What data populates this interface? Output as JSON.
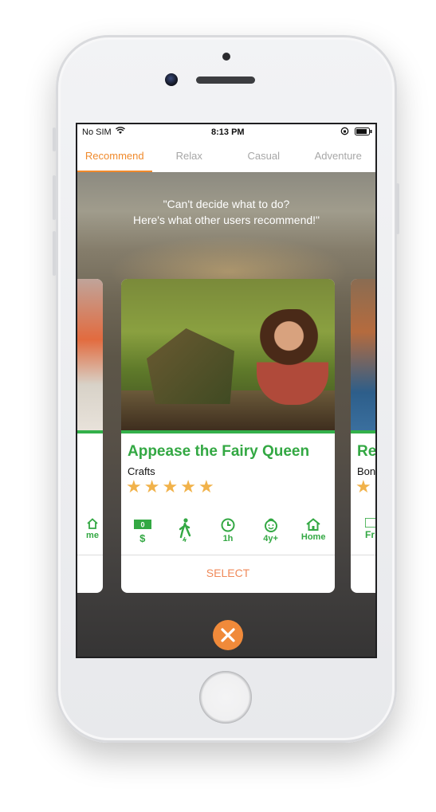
{
  "status_bar": {
    "carrier": "No SIM",
    "time": "8:13 PM"
  },
  "tabs": [
    {
      "label": "Recommend",
      "active": true
    },
    {
      "label": "Relax",
      "active": false
    },
    {
      "label": "Casual",
      "active": false
    },
    {
      "label": "Adventure",
      "active": false
    }
  ],
  "tagline": {
    "line1": "\"Can't decide what to do?",
    "line2": "Here's what other users recommend!\""
  },
  "card": {
    "title": "Appease the Fairy Queen",
    "category": "Crafts",
    "rating": 5,
    "meta": {
      "cost_badge": "0",
      "cost": "$",
      "effort": "",
      "duration": "1h",
      "age": "4y+",
      "location": "Home"
    },
    "select_label": "SELECT"
  },
  "left_card": {
    "meta_label": "me"
  },
  "right_card": {
    "title": "Re",
    "category": "Bon",
    "meta_label": "Fr"
  },
  "colors": {
    "accent": "#f08a2c",
    "green": "#33a843",
    "star": "#f1b24a"
  }
}
